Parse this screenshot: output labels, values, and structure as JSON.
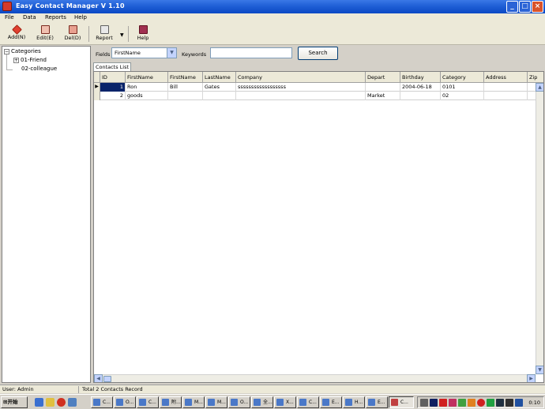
{
  "window": {
    "title": "Easy Contact Manager V 1.10"
  },
  "menu": [
    "File",
    "Data",
    "Reports",
    "Help"
  ],
  "toolbar": {
    "add": "Add(N)",
    "edit": "Edit(E)",
    "del": "Del(D)",
    "report": "Report",
    "help": "Help"
  },
  "tree": {
    "root": "Categories",
    "items": [
      "01-Friend",
      "02-colleague"
    ]
  },
  "filter": {
    "fields_label": "Fields",
    "fields_value": "FirstName",
    "keywords_label": "Keywords",
    "keywords_value": "",
    "search_button": "Search"
  },
  "tab": "Contacts List",
  "grid": {
    "columns": [
      "ID",
      "FirstName",
      "FirstName",
      "LastName",
      "Company",
      "Depart",
      "Birthday",
      "Category",
      "Address",
      "Zip"
    ],
    "rows": [
      {
        "id": "1",
        "c1": "Ron",
        "c2": "Bill",
        "c3": "Gates",
        "company": "ssssssssssssssssss",
        "depart": "",
        "birthday": "2004-06-18",
        "category": "0101",
        "address": "",
        "zip": ""
      },
      {
        "id": "2",
        "c1": "goods",
        "c2": "",
        "c3": "",
        "company": "",
        "depart": "Market",
        "birthday": "",
        "category": "02",
        "address": "",
        "zip": ""
      }
    ]
  },
  "status": {
    "user": "User: Admin",
    "records": "Total 2 Contacts Record"
  },
  "taskbar": {
    "start": "开始",
    "tasks": [
      "C...",
      "O...",
      "C...",
      "附...",
      "M...",
      "M...",
      "O...",
      "全...",
      "X...",
      "C...",
      "E...",
      "H...",
      "E...",
      "C..."
    ],
    "clock": "0:10"
  },
  "colors": {
    "titlebar": "#0b48c4",
    "selection": "#0a246a",
    "chrome": "#ece9d8"
  }
}
